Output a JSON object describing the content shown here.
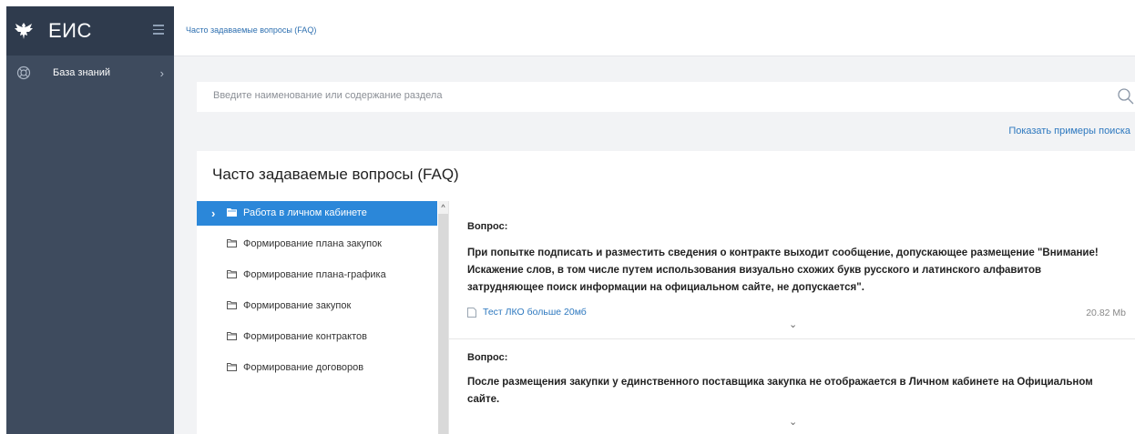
{
  "app": {
    "title": "ЕИС",
    "emblem_icon": "eagle-emblem-icon",
    "menu_icon": "hamburger-icon"
  },
  "sidebar": {
    "items": [
      {
        "label": "База знаний",
        "icon": "lifebuoy-icon",
        "chevron": "›"
      }
    ]
  },
  "breadcrumb": {
    "text": "Часто задаваемые вопросы (FAQ)"
  },
  "search": {
    "placeholder": "Введите наименование или содержание раздела",
    "value": "",
    "icon": "search-icon"
  },
  "search_examples_link": "Показать примеры поиска",
  "panel": {
    "title": "Часто задаваемые вопросы (FAQ)",
    "tree": [
      {
        "label": "Работа в личном кабинете",
        "active": true
      },
      {
        "label": "Формирование плана закупок",
        "active": false
      },
      {
        "label": "Формирование плана-графика",
        "active": false
      },
      {
        "label": "Формирование закупок",
        "active": false
      },
      {
        "label": "Формирование контрактов",
        "active": false
      },
      {
        "label": "Формирование договоров",
        "active": false
      }
    ],
    "questions": [
      {
        "label": "Вопрос:",
        "text": "При попытке подписать и разместить сведения о контракте выходит сообщение, допускающее размещение \"Внимание! Искажение слов, в том числе путем использования визуально схожих букв русского и латинского алфавитов затрудняющее поиск информации на официальном сайте, не допускается\".",
        "attachment": {
          "name": "Тест ЛКО больше 20мб",
          "size": "20.82 Mb"
        }
      },
      {
        "label": "Вопрос:",
        "text": "После размещения закупки у единственного поставщика закупка не отображается в Личном кабинете на Официальном сайте."
      }
    ]
  },
  "colors": {
    "sidebar": "#3e4b5e",
    "sidebar_header": "#2f3b4d",
    "accent": "#2b87d9",
    "link": "#2d78bf"
  }
}
